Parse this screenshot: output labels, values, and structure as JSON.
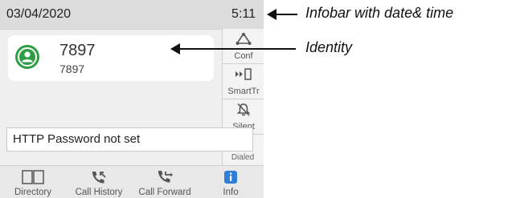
{
  "infobar": {
    "date": "03/04/2020",
    "time": "5:11"
  },
  "call": {
    "number": "7897",
    "sub_number": "7897",
    "avatar_color": "#2e9e45"
  },
  "softkeys": [
    {
      "label": "Conf",
      "icon": "conference-icon"
    },
    {
      "label": "SmartTr",
      "icon": "smart-transfer-icon"
    },
    {
      "label": "Silent",
      "icon": "bell-off-icon"
    }
  ],
  "dialed_hint": "Dialed",
  "notice": {
    "text": "HTTP Password not set"
  },
  "bottom_tabs": [
    {
      "label": "Directory",
      "icon": "book-icon"
    },
    {
      "label": "Call History",
      "icon": "call-history-icon"
    },
    {
      "label": "Call Forward",
      "icon": "call-forward-icon"
    },
    {
      "label": "Info",
      "icon": "info-icon",
      "color": "#2f7fd8"
    }
  ],
  "annotations": {
    "infobar": "Infobar with date& time",
    "identity": "Identity"
  }
}
